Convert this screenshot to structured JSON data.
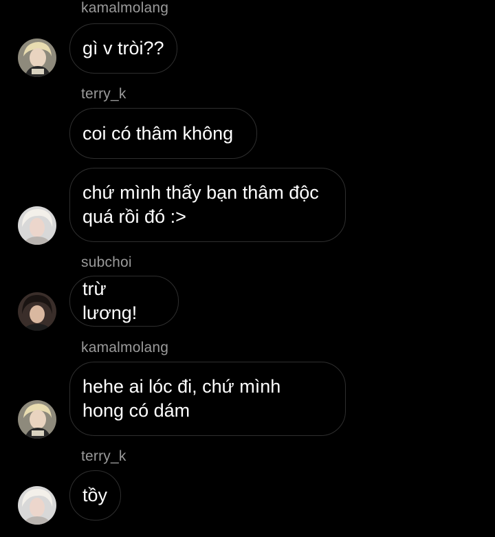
{
  "messages": [
    {
      "sender": "kamalmolang",
      "text": "gì v tròi??"
    },
    {
      "sender": "terry_k",
      "text": "coi có thâm không"
    },
    {
      "sender": "",
      "text": "chứ mình thấy bạn thâm độc quá rồi đó :>"
    },
    {
      "sender": "subchoi",
      "text": "trừ lương!"
    },
    {
      "sender": "kamalmolang",
      "text": "hehe ai lóc đi, chứ mình hong có dám"
    },
    {
      "sender": "terry_k",
      "text": "tồy"
    }
  ],
  "icons": {
    "avatar_kamalmolang": "user-avatar-icon",
    "avatar_terry_k": "user-avatar-icon",
    "avatar_subchoi": "user-avatar-icon"
  },
  "colors": {
    "background": "#000000",
    "bubble_border": "#2f2f2f",
    "sender_text": "#9a9a9a",
    "message_text": "#ffffff"
  }
}
